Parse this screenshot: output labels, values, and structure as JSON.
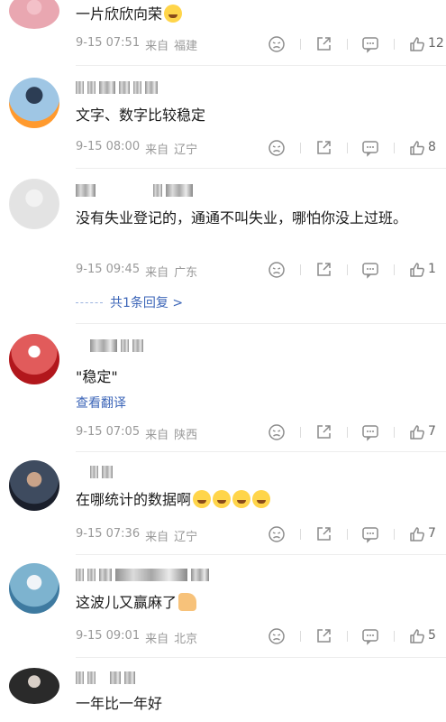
{
  "comments": [
    {
      "text": "一片欣欣向荣",
      "date": "9-15 07:51",
      "source": "来自",
      "location": "福建",
      "likes": "12"
    },
    {
      "text": "文字、数字比较稳定",
      "date": "9-15 08:00",
      "source": "来自",
      "location": "辽宁",
      "likes": "8"
    },
    {
      "text": "没有失业登记的，通通不叫失业，哪怕你没上过班。",
      "date": "9-15 09:45",
      "source": "来自",
      "location": "广东",
      "likes": "1",
      "replies_label": "共1条回复 >"
    },
    {
      "text": "\"稳定\"",
      "translate_label": "查看翻译",
      "date": "9-15 07:05",
      "source": "来自",
      "location": "陕西",
      "likes": "7"
    },
    {
      "text": "在哪统计的数据啊",
      "date": "9-15 07:36",
      "source": "来自",
      "location": "辽宁",
      "likes": "7"
    },
    {
      "text": "这波儿又赢麻了",
      "date": "9-15 09:01",
      "source": "来自",
      "location": "北京",
      "likes": "5"
    },
    {
      "text": "一年比一年好"
    }
  ],
  "icons": [
    "dislike-icon",
    "share-icon",
    "comment-icon",
    "like-icon"
  ]
}
